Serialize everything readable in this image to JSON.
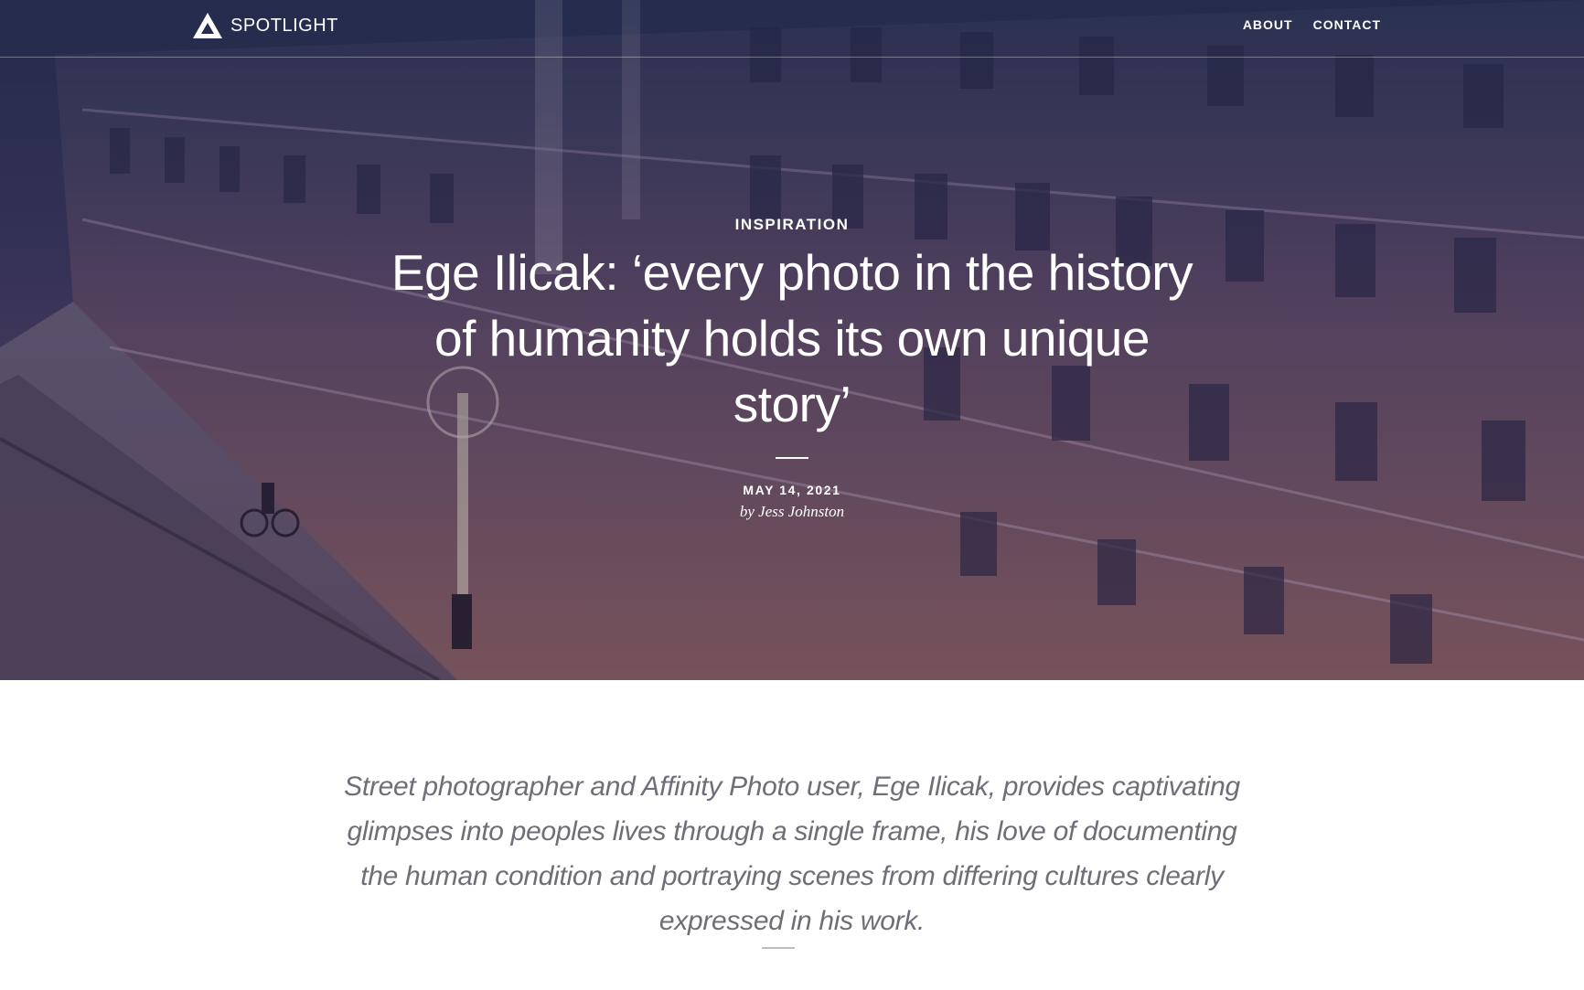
{
  "header": {
    "brand": "SPOTLIGHT",
    "logo_icon": "affinity-triangle-icon",
    "nav": [
      {
        "label": "ABOUT"
      },
      {
        "label": "CONTACT"
      }
    ]
  },
  "hero": {
    "background": "night-city-street-photo",
    "category": "INSPIRATION",
    "title": "Ege Ilicak: ‘every photo in the history of humanity holds its own unique story’",
    "date": "MAY 14, 2021",
    "byline": "by Jess Johnston"
  },
  "article": {
    "intro": "Street photographer and Affinity Photo user, Ege Ilicak, provides captivating glimpses into peoples lives through a single frame, his love of documenting the human condition and portraying scenes from differing cultures clearly expressed in his work."
  },
  "colors": {
    "text_white": "#ffffff",
    "intro_text": "#6e6e78",
    "divider": "#bdbdc2"
  }
}
